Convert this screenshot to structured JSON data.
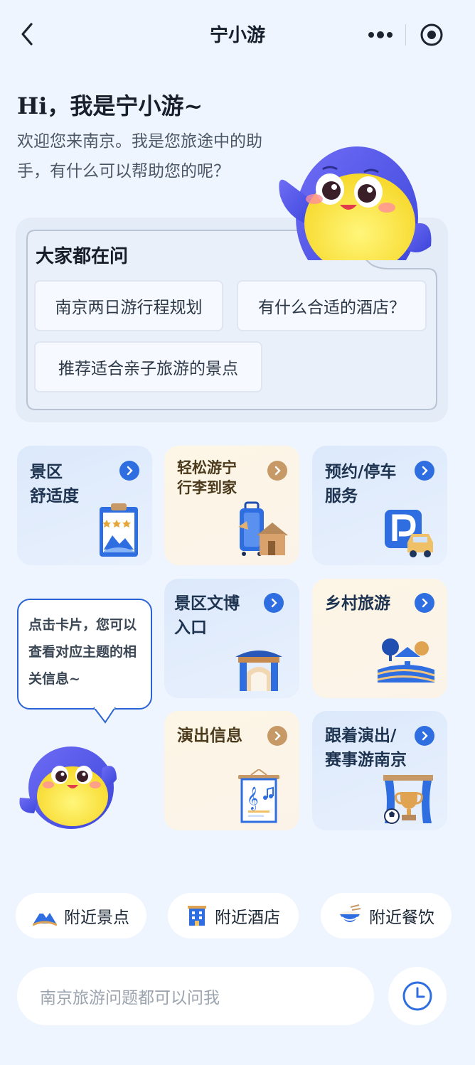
{
  "header": {
    "title": "宁小游"
  },
  "greeting": {
    "headline": "Hi，我是宁小游~",
    "intro": "欢迎您来南京。我是您旅途中的助手，有什么可以帮助您的呢？"
  },
  "faq": {
    "title": "大家都在问",
    "chips": [
      "南京两日游行程规划",
      "有什么合适的酒店？",
      "推荐适合亲子旅游的景点"
    ]
  },
  "cards": [
    {
      "line1": "景区",
      "line2": "舒适度",
      "style": "blue",
      "icon": "scenic-rating-icon"
    },
    {
      "line1": "轻松游宁",
      "line2": "行李到家",
      "style": "cream",
      "icon": "luggage-home-icon"
    },
    {
      "line1": "预约/停车",
      "line2": "服务",
      "style": "blue",
      "icon": "parking-icon"
    },
    {
      "line1": "景区文博",
      "line2": "入口",
      "style": "blue",
      "icon": "museum-gate-icon"
    },
    {
      "line1": "乡村旅游",
      "line2": "",
      "style": "cream",
      "icon": "village-icon"
    },
    {
      "line1": "演出信息",
      "line2": "",
      "style": "cream",
      "icon": "music-poster-icon"
    },
    {
      "line1": "跟着演出/",
      "line2": "赛事游南京",
      "style": "blue",
      "icon": "stage-trophy-icon"
    }
  ],
  "tip": {
    "text": "点击卡片，您可以查看对应主题的相关信息~"
  },
  "nearby": [
    {
      "label": "附近景点",
      "icon": "mountain-icon"
    },
    {
      "label": "附近酒店",
      "icon": "hotel-icon"
    },
    {
      "label": "附近餐饮",
      "icon": "food-bowl-icon"
    }
  ],
  "input": {
    "placeholder": "南京旅游问题都可以问我"
  },
  "colors": {
    "accent": "#2f6ee0",
    "cream_arrow": "#c69966",
    "background": "#eef5ff"
  }
}
